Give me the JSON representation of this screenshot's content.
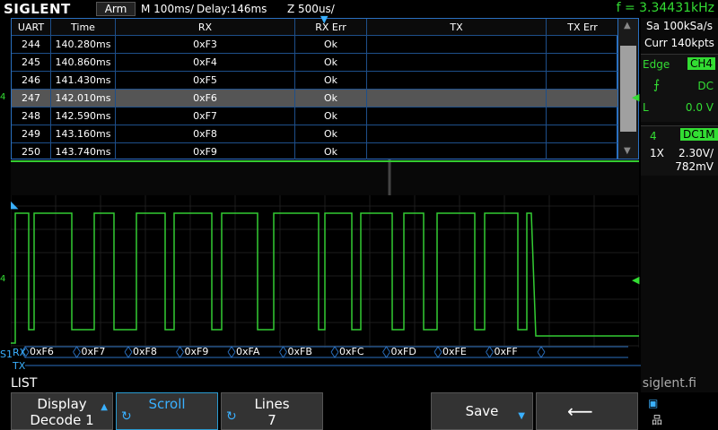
{
  "topbar": {
    "brand": "SIGLENT",
    "trigger_status": "Arm",
    "timebase": "M 100ms/",
    "delay": "Delay:146ms",
    "zoom": "Z 500us/",
    "frequency": "f = 3.34431kHz"
  },
  "right_panel": {
    "sample_rate": "Sa 100kSa/s",
    "memory": "Curr 140kpts",
    "trigger_type": "Edge",
    "trigger_source": "CH4",
    "trigger_coupling": "DC",
    "trigger_level_label": "L",
    "trigger_level": "0.0 V",
    "channel_number": "4",
    "channel_coupling": "DC1M",
    "probe": "1X",
    "volts_div": "2.30V/",
    "offset": "782mV"
  },
  "table": {
    "headers": [
      "UART",
      "Time",
      "RX",
      "RX Err",
      "TX",
      "TX Err"
    ],
    "rows": [
      {
        "uart": "244",
        "time": "140.280ms",
        "rx": "0xF3",
        "rx_err": "Ok",
        "tx": "",
        "tx_err": ""
      },
      {
        "uart": "245",
        "time": "140.860ms",
        "rx": "0xF4",
        "rx_err": "Ok",
        "tx": "",
        "tx_err": ""
      },
      {
        "uart": "246",
        "time": "141.430ms",
        "rx": "0xF5",
        "rx_err": "Ok",
        "tx": "",
        "tx_err": ""
      },
      {
        "uart": "247",
        "time": "142.010ms",
        "rx": "0xF6",
        "rx_err": "Ok",
        "tx": "",
        "tx_err": ""
      },
      {
        "uart": "248",
        "time": "142.590ms",
        "rx": "0xF7",
        "rx_err": "Ok",
        "tx": "",
        "tx_err": ""
      },
      {
        "uart": "249",
        "time": "143.160ms",
        "rx": "0xF8",
        "rx_err": "Ok",
        "tx": "",
        "tx_err": ""
      },
      {
        "uart": "250",
        "time": "143.740ms",
        "rx": "0xF9",
        "rx_err": "Ok",
        "tx": "",
        "tx_err": ""
      }
    ],
    "selected_row": "247"
  },
  "bus": {
    "label": "S1",
    "rx_label": "RX",
    "tx_label": "TX",
    "rx_values": [
      "0xF6",
      "0xF7",
      "0xF8",
      "0xF9",
      "0xFA",
      "0xFB",
      "0xFC",
      "0xFD",
      "0xFE",
      "0xFF"
    ]
  },
  "channel_marker": "4",
  "menu": {
    "title": "LIST",
    "brand_url": "siglent.fi",
    "display_label": "Display",
    "display_value": "Decode 1",
    "scroll_label": "Scroll",
    "lines_label": "Lines",
    "lines_value": "7",
    "save_label": "Save"
  },
  "colors": {
    "trace": "#33cc33",
    "grid": "#2a70c0",
    "accent": "#3ab0ff",
    "channel": "#33dd33"
  }
}
